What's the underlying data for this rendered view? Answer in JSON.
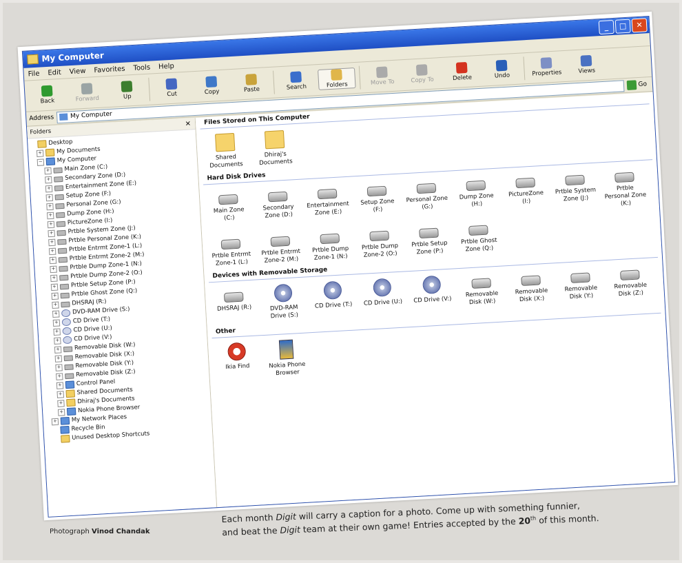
{
  "window": {
    "title": "My Computer",
    "controls": {
      "minimize": "_",
      "maximize": "□",
      "close": "✕"
    }
  },
  "menu": [
    "File",
    "Edit",
    "View",
    "Favorites",
    "Tools",
    "Help"
  ],
  "toolbar": [
    {
      "label": "Back",
      "icon": "back-arrow-icon",
      "state": "normal"
    },
    {
      "label": "Forward",
      "icon": "forward-arrow-icon",
      "state": "disabled"
    },
    {
      "label": "Up",
      "icon": "up-folder-icon",
      "state": "normal"
    },
    {
      "label": "Cut",
      "icon": "scissors-icon",
      "state": "normal"
    },
    {
      "label": "Copy",
      "icon": "copy-icon",
      "state": "normal"
    },
    {
      "label": "Paste",
      "icon": "paste-icon",
      "state": "normal"
    },
    {
      "label": "Search",
      "icon": "search-icon",
      "state": "normal"
    },
    {
      "label": "Folders",
      "icon": "folders-icon",
      "state": "active"
    },
    {
      "label": "Move To",
      "icon": "move-icon",
      "state": "disabled"
    },
    {
      "label": "Copy To",
      "icon": "copy-to-icon",
      "state": "disabled"
    },
    {
      "label": "Delete",
      "icon": "delete-icon",
      "state": "normal"
    },
    {
      "label": "Undo",
      "icon": "undo-icon",
      "state": "normal"
    },
    {
      "label": "Properties",
      "icon": "properties-icon",
      "state": "normal"
    },
    {
      "label": "Views",
      "icon": "views-icon",
      "state": "normal"
    }
  ],
  "address": {
    "label": "Address",
    "value": "My Computer",
    "go_label": "Go"
  },
  "folders_pane": {
    "title": "Folders",
    "close": "✕",
    "tree": [
      {
        "label": "Desktop",
        "icon": "folder",
        "indent": 0,
        "exp": ""
      },
      {
        "label": "My Documents",
        "icon": "folder",
        "indent": 1,
        "exp": "+"
      },
      {
        "label": "My Computer",
        "icon": "computer",
        "indent": 1,
        "exp": "−"
      },
      {
        "label": "Main Zone (C:)",
        "icon": "drive",
        "indent": 2,
        "exp": "+"
      },
      {
        "label": "Secondary Zone (D:)",
        "icon": "drive",
        "indent": 2,
        "exp": "+"
      },
      {
        "label": "Entertainment Zone (E:)",
        "icon": "drive",
        "indent": 2,
        "exp": "+"
      },
      {
        "label": "Setup Zone (F:)",
        "icon": "drive",
        "indent": 2,
        "exp": "+"
      },
      {
        "label": "Personal Zone (G:)",
        "icon": "drive",
        "indent": 2,
        "exp": "+"
      },
      {
        "label": "Dump Zone (H:)",
        "icon": "drive",
        "indent": 2,
        "exp": "+"
      },
      {
        "label": "PictureZone (I:)",
        "icon": "drive",
        "indent": 2,
        "exp": "+"
      },
      {
        "label": "Prtble System Zone (J:)",
        "icon": "drive",
        "indent": 2,
        "exp": "+"
      },
      {
        "label": "Prtble Personal Zone (K:)",
        "icon": "drive",
        "indent": 2,
        "exp": "+"
      },
      {
        "label": "Prtble Entrmt Zone-1 (L:)",
        "icon": "drive",
        "indent": 2,
        "exp": "+"
      },
      {
        "label": "Prtble Entrmt Zone-2 (M:)",
        "icon": "drive",
        "indent": 2,
        "exp": "+"
      },
      {
        "label": "Prtble Dump Zone-1 (N:)",
        "icon": "drive",
        "indent": 2,
        "exp": "+"
      },
      {
        "label": "Prtble Dump Zone-2 (O:)",
        "icon": "drive",
        "indent": 2,
        "exp": "+"
      },
      {
        "label": "Prtble Setup Zone (P:)",
        "icon": "drive",
        "indent": 2,
        "exp": "+"
      },
      {
        "label": "Prtble Ghost Zone (Q:)",
        "icon": "drive",
        "indent": 2,
        "exp": "+"
      },
      {
        "label": "DHSRAJ (R:)",
        "icon": "drive",
        "indent": 2,
        "exp": "+"
      },
      {
        "label": "DVD-RAM Drive (S:)",
        "icon": "cd",
        "indent": 2,
        "exp": "+"
      },
      {
        "label": "CD Drive (T:)",
        "icon": "cd",
        "indent": 2,
        "exp": "+"
      },
      {
        "label": "CD Drive (U:)",
        "icon": "cd",
        "indent": 2,
        "exp": "+"
      },
      {
        "label": "CD Drive (V:)",
        "icon": "cd",
        "indent": 2,
        "exp": "+"
      },
      {
        "label": "Removable Disk (W:)",
        "icon": "drive",
        "indent": 2,
        "exp": "+"
      },
      {
        "label": "Removable Disk (X:)",
        "icon": "drive",
        "indent": 2,
        "exp": "+"
      },
      {
        "label": "Removable Disk (Y:)",
        "icon": "drive",
        "indent": 2,
        "exp": "+"
      },
      {
        "label": "Removable Disk (Z:)",
        "icon": "drive",
        "indent": 2,
        "exp": "+"
      },
      {
        "label": "Control Panel",
        "icon": "computer",
        "indent": 2,
        "exp": "+"
      },
      {
        "label": "Shared Documents",
        "icon": "folder",
        "indent": 2,
        "exp": "+"
      },
      {
        "label": "Dhiraj's Documents",
        "icon": "folder",
        "indent": 2,
        "exp": "+"
      },
      {
        "label": "Nokia Phone Browser",
        "icon": "computer",
        "indent": 2,
        "exp": "+"
      },
      {
        "label": "My Network Places",
        "icon": "computer",
        "indent": 1,
        "exp": "+"
      },
      {
        "label": "Recycle Bin",
        "icon": "computer",
        "indent": 1,
        "exp": ""
      },
      {
        "label": "Unused Desktop Shortcuts",
        "icon": "folder",
        "indent": 1,
        "exp": ""
      }
    ]
  },
  "main": {
    "sections": [
      {
        "title": "Files Stored on This Computer",
        "items": [
          {
            "label": "Shared Documents",
            "icon": "folder"
          },
          {
            "label": "Dhiraj's Documents",
            "icon": "folder"
          }
        ]
      },
      {
        "title": "Hard Disk Drives",
        "items": [
          {
            "label": "Main Zone (C:)",
            "icon": "drive"
          },
          {
            "label": "Secondary Zone (D:)",
            "icon": "drive"
          },
          {
            "label": "Entertainment Zone (E:)",
            "icon": "drive"
          },
          {
            "label": "Setup Zone (F:)",
            "icon": "drive"
          },
          {
            "label": "Personal Zone (G:)",
            "icon": "drive"
          },
          {
            "label": "Dump Zone (H:)",
            "icon": "drive"
          },
          {
            "label": "PictureZone (I:)",
            "icon": "drive"
          },
          {
            "label": "Prtble System Zone (J:)",
            "icon": "drive"
          },
          {
            "label": "Prtble Personal Zone (K:)",
            "icon": "drive"
          },
          {
            "label": "Prtble Entrmt Zone-1 (L:)",
            "icon": "drive"
          },
          {
            "label": "Prtble Entrmt Zone-2 (M:)",
            "icon": "drive"
          },
          {
            "label": "Prtble Dump Zone-1 (N:)",
            "icon": "drive"
          },
          {
            "label": "Prtble Dump Zone-2 (O:)",
            "icon": "drive"
          },
          {
            "label": "Prtble Setup Zone (P:)",
            "icon": "drive"
          },
          {
            "label": "Prtble Ghost Zone (Q:)",
            "icon": "drive"
          }
        ]
      },
      {
        "title": "Devices with Removable Storage",
        "items": [
          {
            "label": "DHSRAJ (R:)",
            "icon": "drive"
          },
          {
            "label": "DVD-RAM Drive (S:)",
            "icon": "cd"
          },
          {
            "label": "CD Drive (T:)",
            "icon": "cd"
          },
          {
            "label": "CD Drive (U:)",
            "icon": "cd"
          },
          {
            "label": "CD Drive (V:)",
            "icon": "cd"
          },
          {
            "label": "Removable Disk (W:)",
            "icon": "drive"
          },
          {
            "label": "Removable Disk (X:)",
            "icon": "drive"
          },
          {
            "label": "Removable Disk (Y:)",
            "icon": "drive"
          },
          {
            "label": "Removable Disk (Z:)",
            "icon": "drive"
          }
        ]
      },
      {
        "title": "Other",
        "items": [
          {
            "label": "Ikia Find",
            "icon": "find"
          },
          {
            "label": "Nokia Phone Browser",
            "icon": "app"
          }
        ]
      }
    ]
  },
  "caption": {
    "credit_prefix": "Photograph",
    "credit_name": "Vinod Chandak",
    "t1": "Each month ",
    "digit": "Digit",
    "t2": " will carry a caption for a photo. Come up with something funnier,",
    "t3": "and beat the ",
    "t4": " team at their own game! Entries accepted by the ",
    "date_num": "20",
    "date_suffix": "th",
    "t5": " of this month."
  }
}
